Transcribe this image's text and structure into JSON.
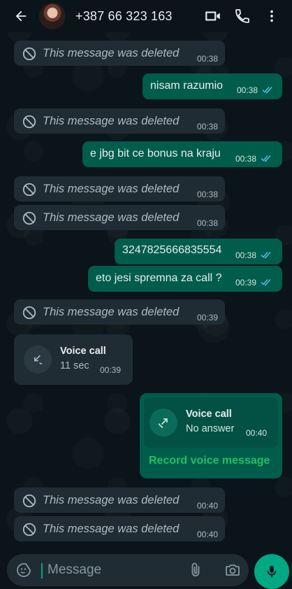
{
  "header": {
    "title": "+387 66 323 163",
    "back_icon": "arrow-left-icon",
    "video_icon": "video-call-icon",
    "voice_icon": "phone-icon",
    "menu_icon": "more-vertical-icon"
  },
  "messages": [
    {
      "type": "deleted",
      "dir": "in",
      "text": "This message was deleted",
      "time": "00:38"
    },
    {
      "type": "text",
      "dir": "out",
      "text": "nisam razumio",
      "time": "00:38"
    },
    {
      "type": "deleted",
      "dir": "in",
      "text": "This message was deleted",
      "time": "00:38"
    },
    {
      "type": "text",
      "dir": "out",
      "text": "e jbg bit ce bonus na kraju",
      "time": "00:38"
    },
    {
      "type": "deleted",
      "dir": "in",
      "text": "This message was deleted",
      "time": "00:38"
    },
    {
      "type": "deleted",
      "dir": "in",
      "text": "This message was deleted",
      "time": "00:38"
    },
    {
      "type": "text",
      "dir": "out",
      "text": "3247825666835554",
      "time": "00:38"
    },
    {
      "type": "text",
      "dir": "out",
      "text": "eto jesi spremna za call ?",
      "time": "00:39"
    },
    {
      "type": "deleted",
      "dir": "in",
      "text": "This message was deleted",
      "time": "00:39"
    },
    {
      "type": "call",
      "dir": "in",
      "title": "Voice call",
      "sub": "11 sec",
      "time": "00:39"
    },
    {
      "type": "call",
      "dir": "out",
      "title": "Voice call",
      "sub": "No answer",
      "time": "00:40",
      "action": "Record voice message"
    },
    {
      "type": "deleted",
      "dir": "in",
      "text": "This message was deleted",
      "time": "00:40"
    },
    {
      "type": "deleted",
      "dir": "in",
      "text": "This message was deleted",
      "time": "00:40"
    }
  ],
  "composer": {
    "placeholder": "Message",
    "emoji_icon": "emoji-sticker-icon",
    "attach_icon": "paperclip-icon",
    "camera_icon": "camera-icon",
    "mic_icon": "microphone-icon"
  },
  "colors": {
    "background": "#0b141a",
    "incoming": "#202c33",
    "outgoing": "#005c4b",
    "accent": "#00a884",
    "read_ticks": "#53bdeb"
  }
}
